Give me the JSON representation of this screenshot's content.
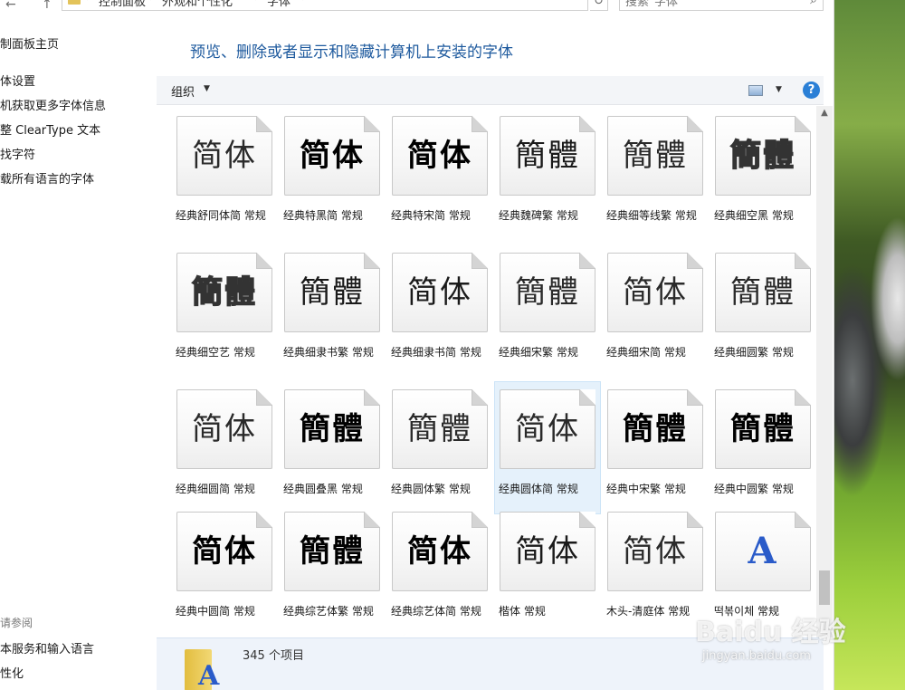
{
  "address_bar": {
    "back_arrow": "←",
    "up_arrow": "↑",
    "crumbs": [
      "控制面板",
      "外观和个性化",
      "字体"
    ],
    "search_placeholder": "搜索\"字体\""
  },
  "left_pane": {
    "links": [
      "制面板主页",
      "体设置",
      "机获取更多字体信息",
      "整 ClearType 文本",
      "找字符",
      "载所有语言的字体"
    ],
    "see_also_title": "请参阅",
    "see_also_links": [
      "本服务和输入语言",
      "性化"
    ]
  },
  "header": {
    "title": "预览、删除或者显示和隐藏计算机上安装的字体"
  },
  "toolbar": {
    "organize_label": "组织",
    "help_label": "?"
  },
  "fonts": [
    {
      "sample": "简体",
      "style": "light",
      "label": "经典舒同体简 常规"
    },
    {
      "sample": "简体",
      "style": "bold",
      "label": "经典特黑简 常规"
    },
    {
      "sample": "简体",
      "style": "bold",
      "label": "经典特宋简 常规"
    },
    {
      "sample": "簡體",
      "style": "serif",
      "label": "经典魏碑繁 常规"
    },
    {
      "sample": "簡體",
      "style": "light",
      "label": "经典细等线繁 常规"
    },
    {
      "sample": "簡體",
      "style": "hollow",
      "label": "经典细空黑 常规"
    },
    {
      "sample": "簡體",
      "style": "hollow",
      "label": "经典细空艺 常规"
    },
    {
      "sample": "簡體",
      "style": "serif",
      "label": "经典细隶书繁 常规"
    },
    {
      "sample": "简体",
      "style": "serif",
      "label": "经典细隶书简 常规"
    },
    {
      "sample": "簡體",
      "style": "light",
      "label": "经典细宋繁 常规"
    },
    {
      "sample": "简体",
      "style": "light",
      "label": "经典细宋简 常规"
    },
    {
      "sample": "簡體",
      "style": "light",
      "label": "经典细圆繁 常规"
    },
    {
      "sample": "简体",
      "style": "light",
      "label": "经典细圆简 常规"
    },
    {
      "sample": "簡體",
      "style": "bold",
      "label": "经典圆叠黑 常规"
    },
    {
      "sample": "簡體",
      "style": "light",
      "label": "经典圆体繁 常规"
    },
    {
      "sample": "简体",
      "style": "light",
      "label": "经典圆体简 常规",
      "selected": true
    },
    {
      "sample": "簡體",
      "style": "bold",
      "label": "经典中宋繁 常规"
    },
    {
      "sample": "簡體",
      "style": "bold",
      "label": "经典中圆繁 常规"
    },
    {
      "sample": "简体",
      "style": "bold",
      "label": "经典中圆简 常规"
    },
    {
      "sample": "簡體",
      "style": "bold",
      "label": "经典综艺体繁 常规"
    },
    {
      "sample": "简体",
      "style": "bold",
      "label": "经典综艺体简 常规"
    },
    {
      "sample": "简体",
      "style": "serif",
      "label": "楷体 常规"
    },
    {
      "sample": "简体",
      "style": "light",
      "label": "木头-清庭体 常规"
    },
    {
      "sample": "A",
      "style": "latin",
      "label": "떡볶이체 常规"
    }
  ],
  "details": {
    "item_count": "345 个项目",
    "preview_letter": "A"
  },
  "watermark": {
    "main": "Baidu 经验",
    "sub": "jingyan.baidu.com"
  }
}
